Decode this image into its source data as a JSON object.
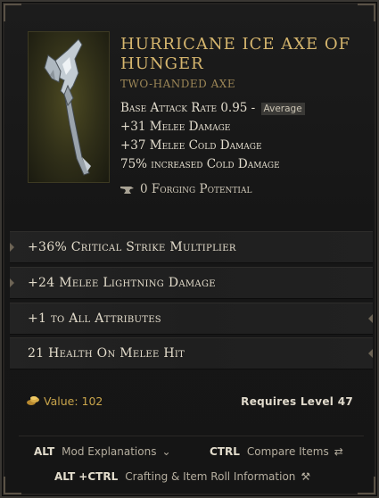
{
  "item": {
    "name": "Hurricane Ice Axe of Hunger",
    "type": "Two-Handed Axe",
    "stats": {
      "attack_rate": "Base Attack Rate 0.95 -",
      "attack_rating": "Average",
      "melee_damage": "+31 Melee Damage",
      "cold_damage": "+37 Melee Cold Damage",
      "increased_cold": "75% increased Cold Damage"
    },
    "forging": "0 Forging Potential"
  },
  "affixes": [
    "+36% Critical Strike Multiplier",
    "+24 Melee Lightning Damage",
    "+1 to All Attributes",
    "21 Health On Melee Hit"
  ],
  "footer": {
    "value": "Value: 102",
    "requirement": "Requires Level 47"
  },
  "keybinds": {
    "mod": {
      "key": "ALT",
      "label": "Mod Explanations"
    },
    "compare": {
      "key": "CTRL",
      "label": "Compare Items"
    },
    "crafting": {
      "key": "ALT +CTRL",
      "label": "Crafting & Item Roll Information"
    }
  },
  "colors": {
    "title": "#d6b66e",
    "subtype": "#9d8757",
    "value": "#c8a44b",
    "frame_bg": "#4d4a22"
  },
  "icons": [
    "axe-item-icon",
    "anvil-icon",
    "coin-icon",
    "chevron-down-icon",
    "compare-arrows-icon",
    "hammer-icon"
  ]
}
